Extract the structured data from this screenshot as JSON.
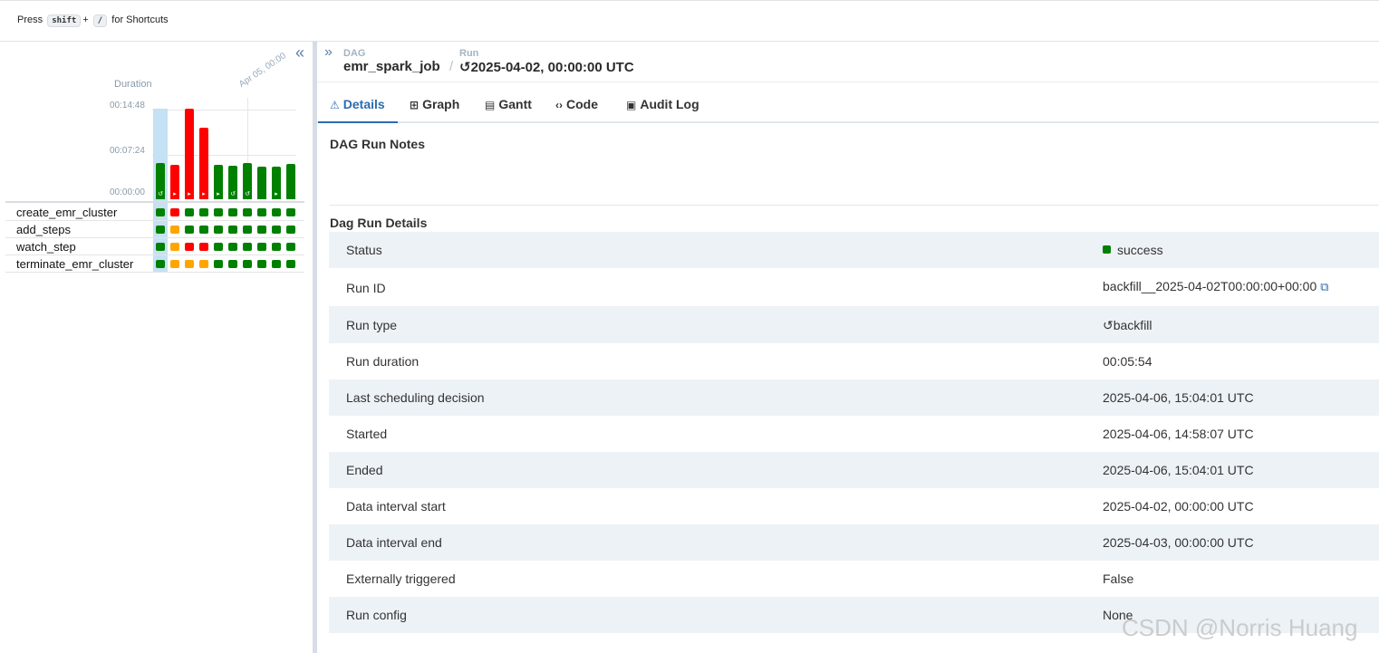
{
  "topbar": {
    "shortcut_prefix": "Press",
    "shortcut_key1": "shift",
    "shortcut_plus": "+",
    "shortcut_key2": "/",
    "shortcut_suffix": "for Shortcuts"
  },
  "grid": {
    "collapse_icon": "double-chevron-left-icon",
    "duration_label": "Duration",
    "y_ticks": [
      "00:14:48",
      "00:07:24",
      "00:00:00"
    ],
    "date_marker": "Apr 05, 00:00",
    "run_colors": {
      "success": "#008000",
      "failed": "#ff0000",
      "upstream_failed": "#ffa500"
    },
    "runs": [
      {
        "duration_fraction": 0.4,
        "state": "success",
        "type": "backfill",
        "icon": "↺"
      },
      {
        "duration_fraction": 0.38,
        "state": "failed",
        "type": "manual",
        "icon": "▸"
      },
      {
        "duration_fraction": 1.0,
        "state": "failed",
        "type": "manual",
        "icon": "▸"
      },
      {
        "duration_fraction": 0.79,
        "state": "failed",
        "type": "manual",
        "icon": "▸"
      },
      {
        "duration_fraction": 0.38,
        "state": "success",
        "type": "manual",
        "icon": "▸"
      },
      {
        "duration_fraction": 0.37,
        "state": "success",
        "type": "backfill",
        "icon": "↺"
      },
      {
        "duration_fraction": 0.4,
        "state": "success",
        "type": "backfill",
        "icon": "↺"
      },
      {
        "duration_fraction": 0.36,
        "state": "success",
        "type": "none",
        "icon": ""
      },
      {
        "duration_fraction": 0.36,
        "state": "success",
        "type": "manual",
        "icon": "▸"
      },
      {
        "duration_fraction": 0.39,
        "state": "success",
        "type": "none",
        "icon": ""
      }
    ],
    "tasks": [
      {
        "name": "create_emr_cluster",
        "states": [
          "success",
          "failed",
          "success",
          "success",
          "success",
          "success",
          "success",
          "success",
          "success",
          "success"
        ]
      },
      {
        "name": "add_steps",
        "states": [
          "success",
          "upstream_failed",
          "success",
          "success",
          "success",
          "success",
          "success",
          "success",
          "success",
          "success"
        ]
      },
      {
        "name": "watch_step",
        "states": [
          "success",
          "upstream_failed",
          "failed",
          "failed",
          "success",
          "success",
          "success",
          "success",
          "success",
          "success"
        ]
      },
      {
        "name": "terminate_emr_cluster",
        "states": [
          "success",
          "upstream_failed",
          "upstream_failed",
          "upstream_failed",
          "success",
          "success",
          "success",
          "success",
          "success",
          "success"
        ]
      }
    ]
  },
  "header": {
    "expand_icon": "double-chevron-right-icon",
    "dag_label": "DAG",
    "run_label": "Run",
    "dag_name": "emr_spark_job",
    "separator": "/",
    "run_icon": "↺",
    "run_name": "2025-04-02, 00:00:00 UTC"
  },
  "tabs": [
    {
      "label": "Details",
      "icon": "⚠",
      "icon_name": "warning-triangle-icon",
      "active": true
    },
    {
      "label": "Graph",
      "icon": "⊞",
      "icon_name": "graph-icon",
      "active": false
    },
    {
      "label": "Gantt",
      "icon": "▤",
      "icon_name": "gantt-icon",
      "active": false
    },
    {
      "label": "Code",
      "icon": "‹›",
      "icon_name": "code-icon",
      "active": false
    },
    {
      "label": "Audit Log",
      "icon": "▣",
      "icon_name": "audit-log-icon",
      "active": false
    }
  ],
  "notes": {
    "title": "DAG Run Notes"
  },
  "details": {
    "title": "Dag Run Details",
    "rows": [
      {
        "key": "Status",
        "value": "success"
      },
      {
        "key": "Run ID",
        "value": "backfill__2025-04-02T00:00:00+00:00"
      },
      {
        "key": "Run type",
        "value": "backfill"
      },
      {
        "key": "Run duration",
        "value": "00:05:54"
      },
      {
        "key": "Last scheduling decision",
        "value": "2025-04-06, 15:04:01 UTC"
      },
      {
        "key": "Started",
        "value": "2025-04-06, 14:58:07 UTC"
      },
      {
        "key": "Ended",
        "value": "2025-04-06, 15:04:01 UTC"
      },
      {
        "key": "Data interval start",
        "value": "2025-04-02, 00:00:00 UTC"
      },
      {
        "key": "Data interval end",
        "value": "2025-04-03, 00:00:00 UTC"
      },
      {
        "key": "Externally triggered",
        "value": "False"
      },
      {
        "key": "Run config",
        "value": "None"
      }
    ]
  },
  "watermark": "CSDN @Norris Huang"
}
